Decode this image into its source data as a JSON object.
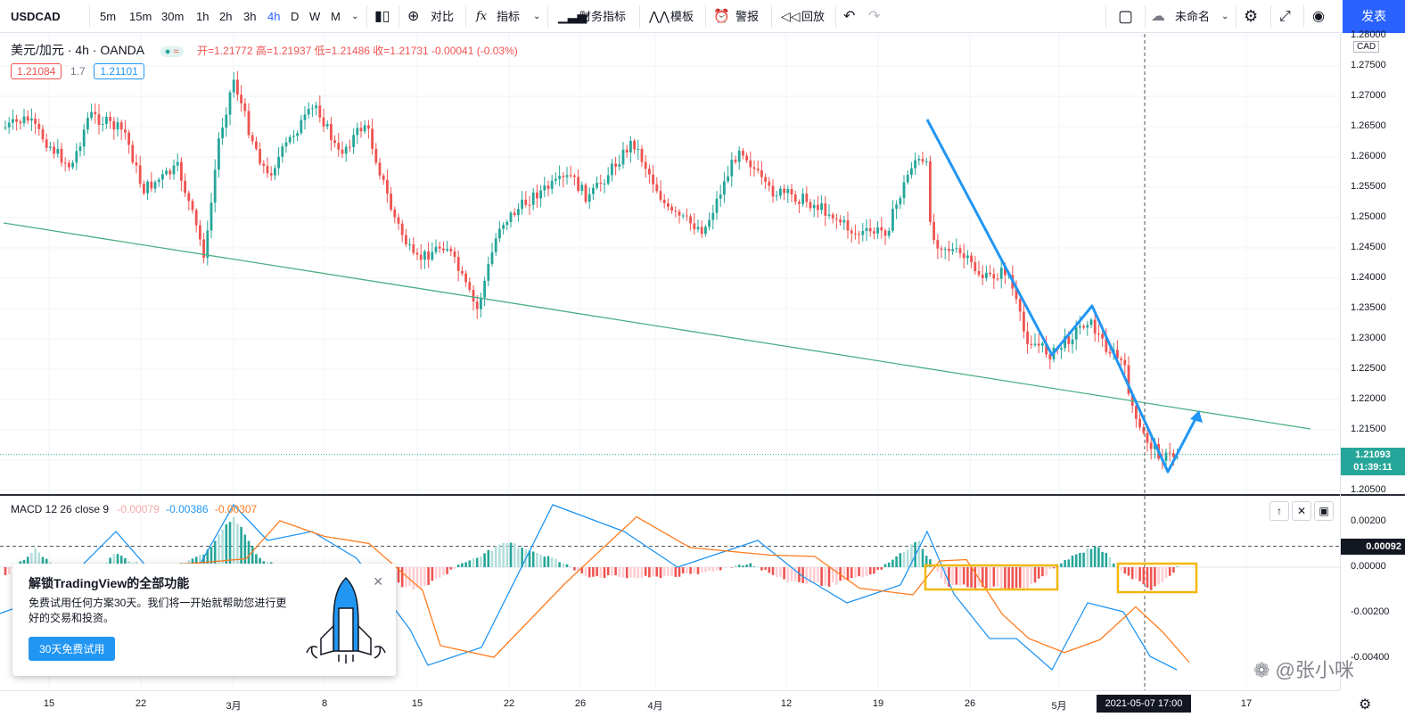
{
  "toolbar": {
    "symbol": "USDCAD",
    "intervals": [
      "5m",
      "15m",
      "30m",
      "1h",
      "2h",
      "3h",
      "4h",
      "D",
      "W",
      "M"
    ],
    "active_interval": "4h",
    "compare": "对比",
    "indicators": "指标",
    "financials": "财务指标",
    "templates": "模板",
    "alert": "警报",
    "replay": "回放",
    "layout_name": "未命名",
    "publish": "发表"
  },
  "legend": {
    "pair": "美元/加元 · 4h · OANDA",
    "ohlc": "开=1.21772 高=1.21937 低=1.21486 收=1.21731 -0.00041 (-0.03%)",
    "bid": "1.21084",
    "spread": "1.7",
    "ask": "1.21101"
  },
  "macd": {
    "label": "MACD 12 26 close 9",
    "hist": "-0.00079",
    "macd": "-0.00386",
    "signal": "-0.00307"
  },
  "price_axis": {
    "currency": "CAD",
    "ticks": [
      "1.28000",
      "1.27500",
      "1.27000",
      "1.26500",
      "1.26000",
      "1.25500",
      "1.25000",
      "1.24500",
      "1.24000",
      "1.23500",
      "1.23000",
      "1.22500",
      "1.22000",
      "1.21500",
      "1.21000",
      "1.20500"
    ],
    "last_price": "1.21093",
    "countdown": "01:39:11",
    "macd_ticks": [
      "0.00200",
      "0.00000",
      "-0.00200",
      "-0.00400"
    ],
    "macd_marker": "0.00092"
  },
  "time_axis": {
    "labels": [
      "15",
      "22",
      "3月",
      "8",
      "15",
      "22",
      "26",
      "4月",
      "12",
      "19",
      "26",
      "5月",
      "17"
    ],
    "cursor_label": "2021-05-07  17:00"
  },
  "promo": {
    "title": "解锁TradingView的全部功能",
    "body": "免费试用任何方案30天。我们将一开始就帮助您进行更好的交易和投资。",
    "button": "30天免费试用"
  },
  "watermark": "张小咪",
  "colors": {
    "up": "#26a69a",
    "down": "#ef5350",
    "accent": "#2962ff",
    "arrow": "#2196f3",
    "trendline": "#4caf85",
    "highlight": "#f2b70a",
    "macd": "#2196f3",
    "signal": "#ff7c1f"
  }
}
